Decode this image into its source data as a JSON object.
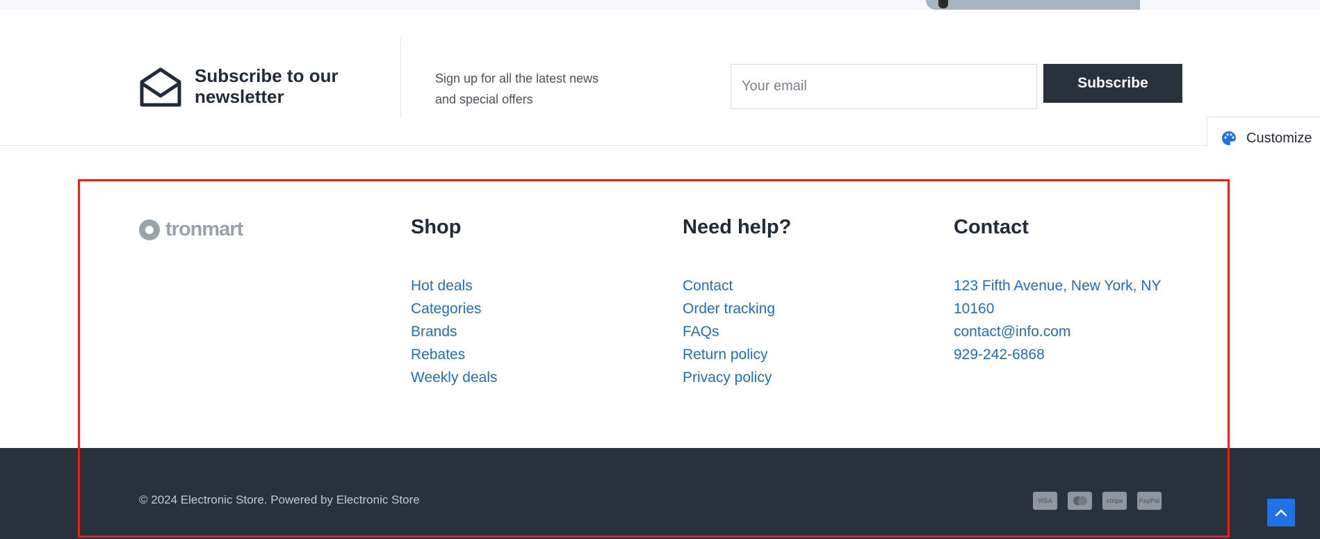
{
  "newsletter": {
    "title": "Subscribe to our newsletter",
    "description": "Sign up for all the latest news and special offers",
    "email_placeholder": "Your email",
    "subscribe_label": "Subscribe",
    "icon": "envelope-open-icon"
  },
  "customize": {
    "label": "Customize",
    "icon": "palette-icon"
  },
  "footer": {
    "logo_text": "tronmart",
    "shop": {
      "title": "Shop",
      "links": [
        "Hot deals",
        "Categories",
        "Brands",
        "Rebates",
        "Weekly deals"
      ]
    },
    "help": {
      "title": "Need help?",
      "links": [
        "Contact",
        "Order tracking",
        "FAQs",
        "Return policy",
        "Privacy policy"
      ]
    },
    "contact": {
      "title": "Contact",
      "address": "123 Fifth Avenue, New York, NY 10160",
      "email": "contact@info.com",
      "phone": "929-242-6868"
    }
  },
  "bottom": {
    "copyright": "© 2024 Electronic Store. Powered by Electronic Store",
    "payment_methods": [
      {
        "name": "visa-icon",
        "label": "VISA"
      },
      {
        "name": "mastercard-icon",
        "label": ""
      },
      {
        "name": "stripe-icon",
        "label": "stripe"
      },
      {
        "name": "paypal-icon",
        "label": "PayPal"
      }
    ]
  },
  "colors": {
    "accent": "#1e73e8",
    "link": "#1e6fbf",
    "dark": "#29313c",
    "highlight": "#e1251b"
  }
}
